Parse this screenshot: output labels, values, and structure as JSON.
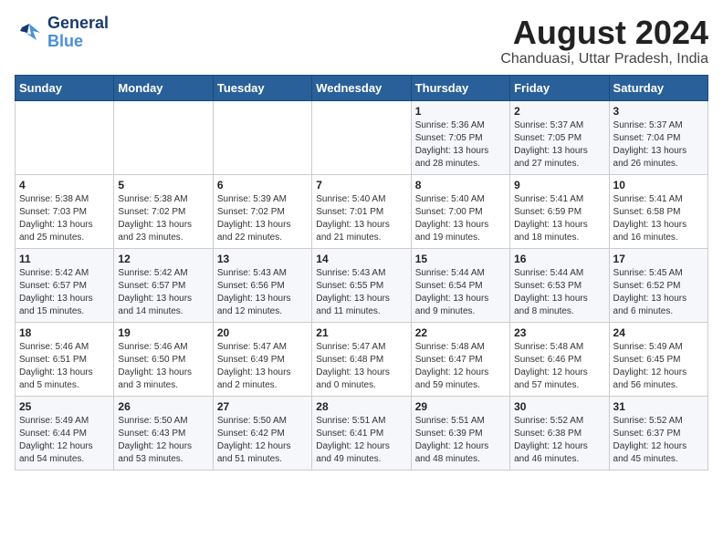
{
  "logo": {
    "line1": "General",
    "line2": "Blue"
  },
  "title": "August 2024",
  "subtitle": "Chanduasi, Uttar Pradesh, India",
  "days_of_week": [
    "Sunday",
    "Monday",
    "Tuesday",
    "Wednesday",
    "Thursday",
    "Friday",
    "Saturday"
  ],
  "weeks": [
    [
      {
        "day": "",
        "info": ""
      },
      {
        "day": "",
        "info": ""
      },
      {
        "day": "",
        "info": ""
      },
      {
        "day": "",
        "info": ""
      },
      {
        "day": "1",
        "info": "Sunrise: 5:36 AM\nSunset: 7:05 PM\nDaylight: 13 hours\nand 28 minutes."
      },
      {
        "day": "2",
        "info": "Sunrise: 5:37 AM\nSunset: 7:05 PM\nDaylight: 13 hours\nand 27 minutes."
      },
      {
        "day": "3",
        "info": "Sunrise: 5:37 AM\nSunset: 7:04 PM\nDaylight: 13 hours\nand 26 minutes."
      }
    ],
    [
      {
        "day": "4",
        "info": "Sunrise: 5:38 AM\nSunset: 7:03 PM\nDaylight: 13 hours\nand 25 minutes."
      },
      {
        "day": "5",
        "info": "Sunrise: 5:38 AM\nSunset: 7:02 PM\nDaylight: 13 hours\nand 23 minutes."
      },
      {
        "day": "6",
        "info": "Sunrise: 5:39 AM\nSunset: 7:02 PM\nDaylight: 13 hours\nand 22 minutes."
      },
      {
        "day": "7",
        "info": "Sunrise: 5:40 AM\nSunset: 7:01 PM\nDaylight: 13 hours\nand 21 minutes."
      },
      {
        "day": "8",
        "info": "Sunrise: 5:40 AM\nSunset: 7:00 PM\nDaylight: 13 hours\nand 19 minutes."
      },
      {
        "day": "9",
        "info": "Sunrise: 5:41 AM\nSunset: 6:59 PM\nDaylight: 13 hours\nand 18 minutes."
      },
      {
        "day": "10",
        "info": "Sunrise: 5:41 AM\nSunset: 6:58 PM\nDaylight: 13 hours\nand 16 minutes."
      }
    ],
    [
      {
        "day": "11",
        "info": "Sunrise: 5:42 AM\nSunset: 6:57 PM\nDaylight: 13 hours\nand 15 minutes."
      },
      {
        "day": "12",
        "info": "Sunrise: 5:42 AM\nSunset: 6:57 PM\nDaylight: 13 hours\nand 14 minutes."
      },
      {
        "day": "13",
        "info": "Sunrise: 5:43 AM\nSunset: 6:56 PM\nDaylight: 13 hours\nand 12 minutes."
      },
      {
        "day": "14",
        "info": "Sunrise: 5:43 AM\nSunset: 6:55 PM\nDaylight: 13 hours\nand 11 minutes."
      },
      {
        "day": "15",
        "info": "Sunrise: 5:44 AM\nSunset: 6:54 PM\nDaylight: 13 hours\nand 9 minutes."
      },
      {
        "day": "16",
        "info": "Sunrise: 5:44 AM\nSunset: 6:53 PM\nDaylight: 13 hours\nand 8 minutes."
      },
      {
        "day": "17",
        "info": "Sunrise: 5:45 AM\nSunset: 6:52 PM\nDaylight: 13 hours\nand 6 minutes."
      }
    ],
    [
      {
        "day": "18",
        "info": "Sunrise: 5:46 AM\nSunset: 6:51 PM\nDaylight: 13 hours\nand 5 minutes."
      },
      {
        "day": "19",
        "info": "Sunrise: 5:46 AM\nSunset: 6:50 PM\nDaylight: 13 hours\nand 3 minutes."
      },
      {
        "day": "20",
        "info": "Sunrise: 5:47 AM\nSunset: 6:49 PM\nDaylight: 13 hours\nand 2 minutes."
      },
      {
        "day": "21",
        "info": "Sunrise: 5:47 AM\nSunset: 6:48 PM\nDaylight: 13 hours\nand 0 minutes."
      },
      {
        "day": "22",
        "info": "Sunrise: 5:48 AM\nSunset: 6:47 PM\nDaylight: 12 hours\nand 59 minutes."
      },
      {
        "day": "23",
        "info": "Sunrise: 5:48 AM\nSunset: 6:46 PM\nDaylight: 12 hours\nand 57 minutes."
      },
      {
        "day": "24",
        "info": "Sunrise: 5:49 AM\nSunset: 6:45 PM\nDaylight: 12 hours\nand 56 minutes."
      }
    ],
    [
      {
        "day": "25",
        "info": "Sunrise: 5:49 AM\nSunset: 6:44 PM\nDaylight: 12 hours\nand 54 minutes."
      },
      {
        "day": "26",
        "info": "Sunrise: 5:50 AM\nSunset: 6:43 PM\nDaylight: 12 hours\nand 53 minutes."
      },
      {
        "day": "27",
        "info": "Sunrise: 5:50 AM\nSunset: 6:42 PM\nDaylight: 12 hours\nand 51 minutes."
      },
      {
        "day": "28",
        "info": "Sunrise: 5:51 AM\nSunset: 6:41 PM\nDaylight: 12 hours\nand 49 minutes."
      },
      {
        "day": "29",
        "info": "Sunrise: 5:51 AM\nSunset: 6:39 PM\nDaylight: 12 hours\nand 48 minutes."
      },
      {
        "day": "30",
        "info": "Sunrise: 5:52 AM\nSunset: 6:38 PM\nDaylight: 12 hours\nand 46 minutes."
      },
      {
        "day": "31",
        "info": "Sunrise: 5:52 AM\nSunset: 6:37 PM\nDaylight: 12 hours\nand 45 minutes."
      }
    ]
  ]
}
